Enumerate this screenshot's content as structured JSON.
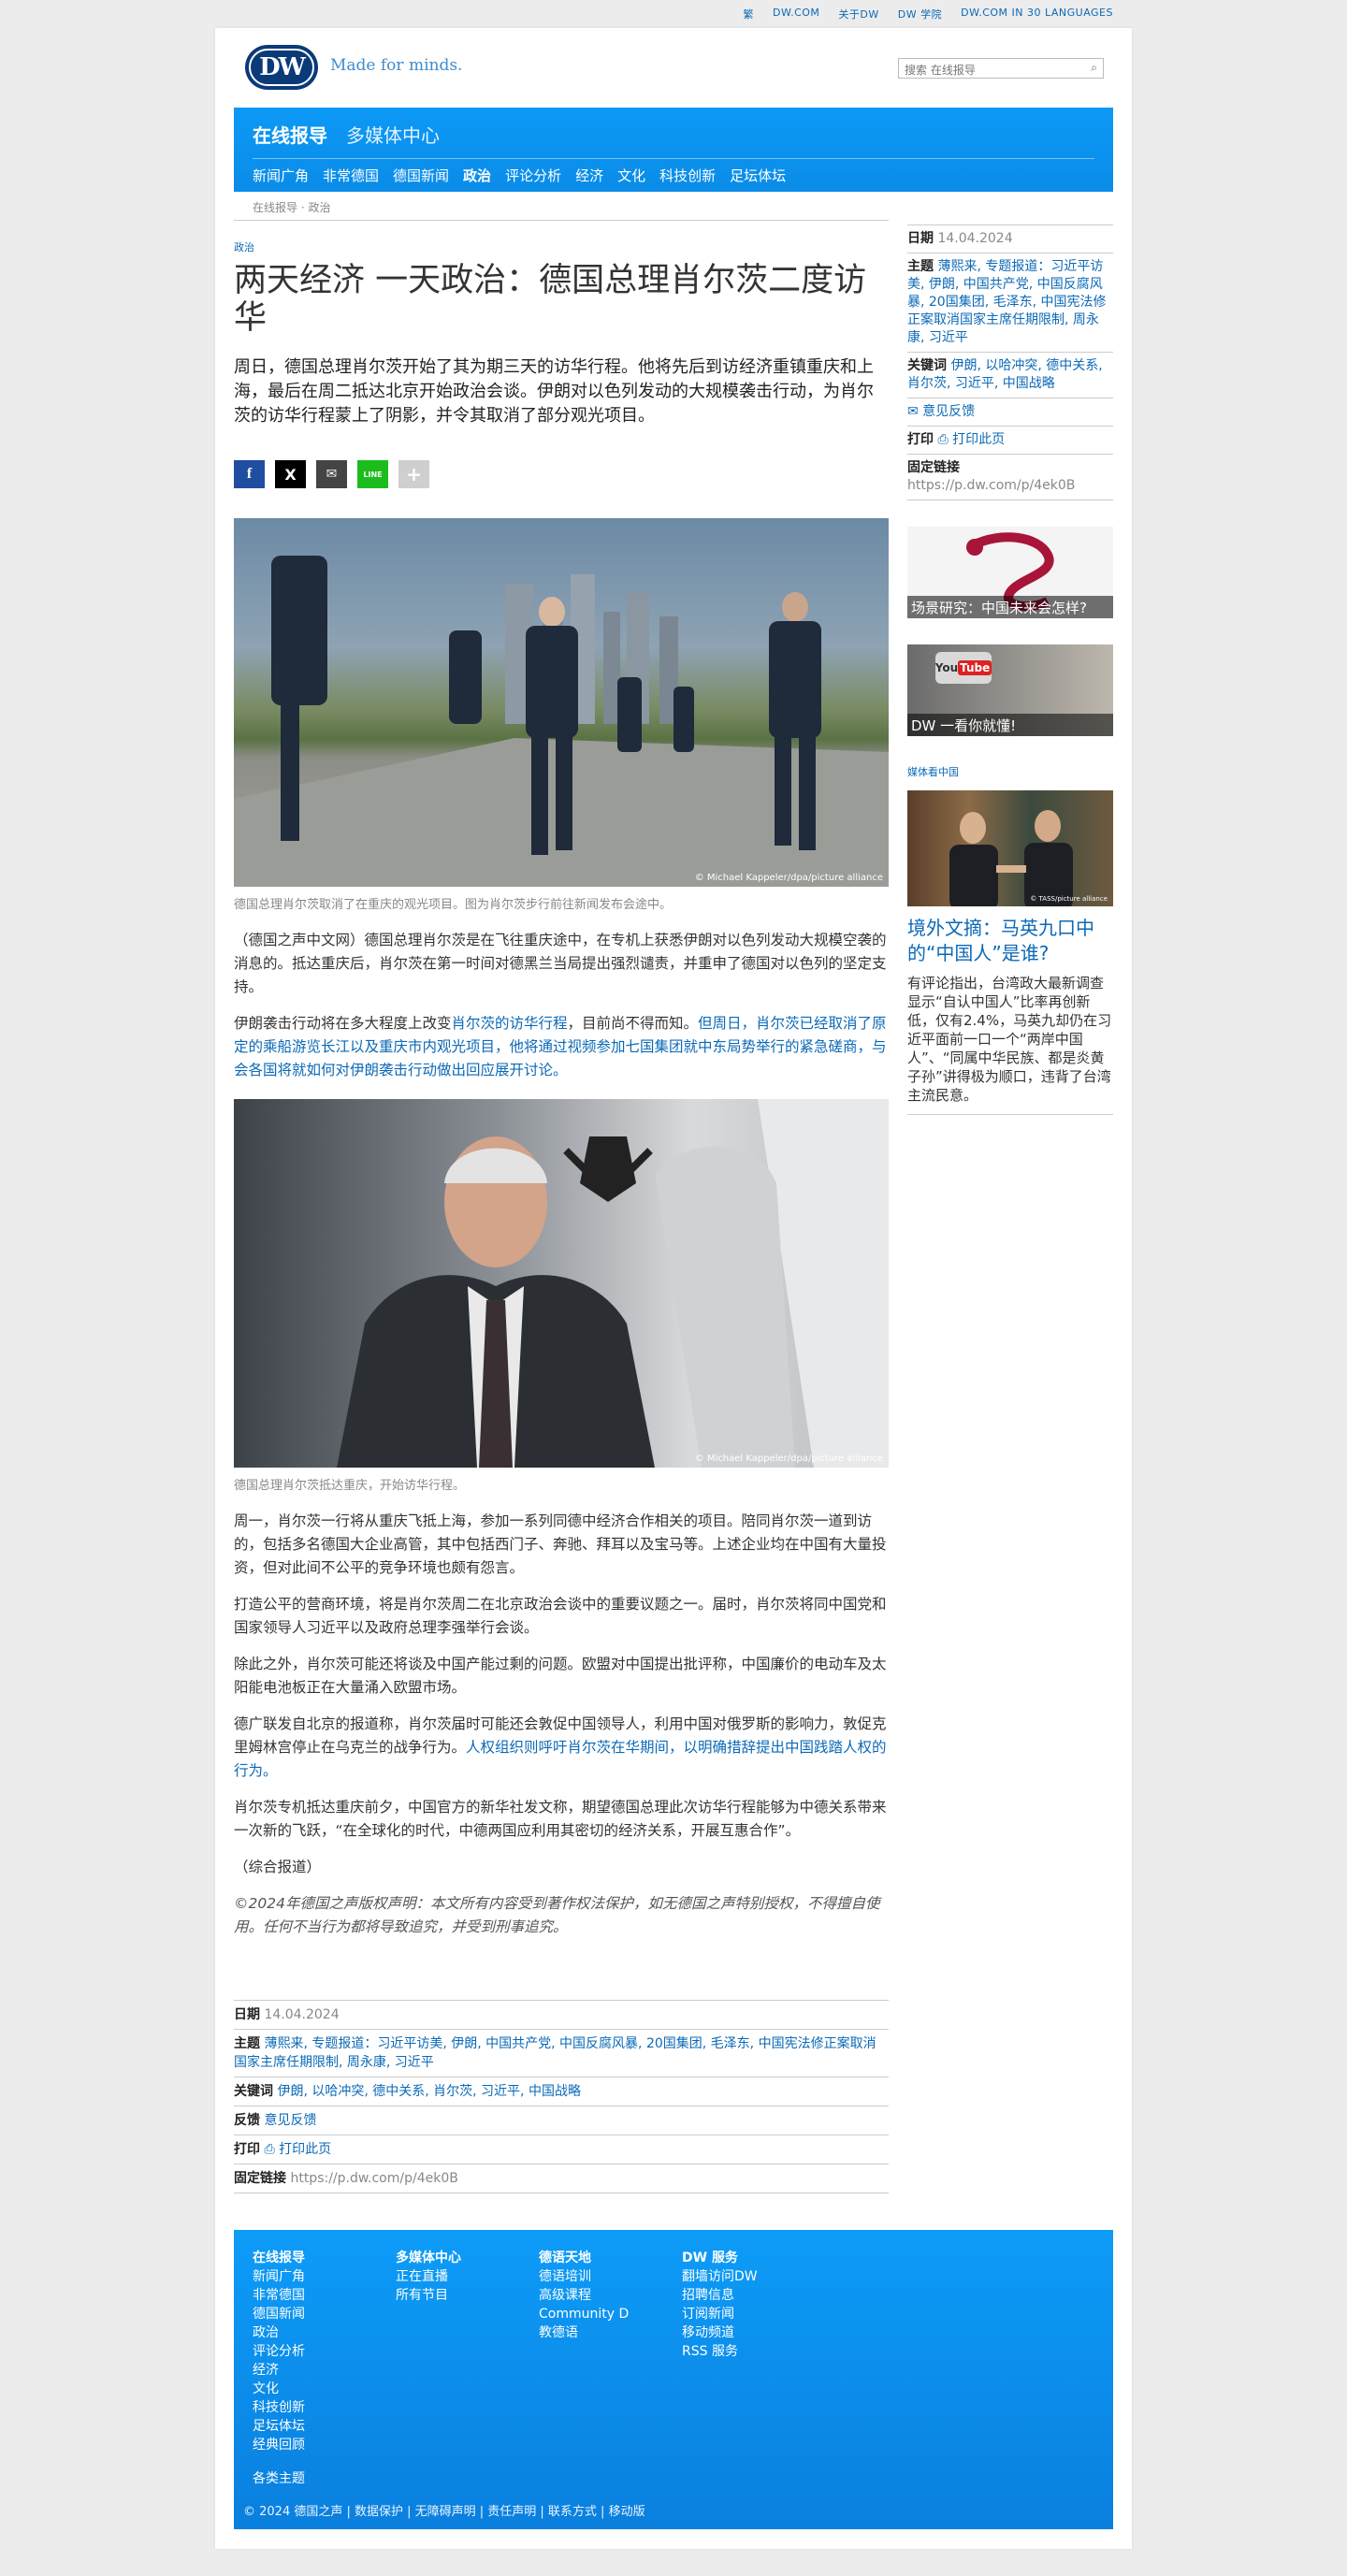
{
  "top_links": [
    "繁",
    "DW.COM",
    "关于DW",
    "DW 学院",
    "DW.COM IN 30 LANGUAGES"
  ],
  "header": {
    "logo_text": "DW",
    "tagline": "Made for minds.",
    "search_placeholder": "搜索 在线报导"
  },
  "nav": {
    "primary": [
      "在线报导",
      "多媒体中心"
    ],
    "secondary": [
      "新闻广角",
      "非常德国",
      "德国新闻",
      "政治",
      "评论分析",
      "经济",
      "文化",
      "科技创新",
      "足坛体坛"
    ],
    "active_secondary": "政治"
  },
  "breadcrumb": "在线报导 · 政治",
  "article": {
    "kicker": "政治",
    "title": "两天经济 一天政治：德国总理肖尔茨二度访华",
    "lead": "周日，德国总理肖尔茨开始了其为期三天的访华行程。他将先后到访经济重镇重庆和上海，最后在周二抵达北京开始政治会谈。伊朗对以色列发动的大规模袭击行动，为肖尔茨的访华行程蒙上了阴影，并令其取消了部分观光项目。",
    "share": [
      "f",
      "X",
      "✉",
      "LINE",
      "+"
    ],
    "image1_credit": "© Michael Kappeler/dpa/picture alliance",
    "image1_caption": "德国总理肖尔茨取消了在重庆的观光项目。图为肖尔茨步行前往新闻发布会途中。",
    "p1": "（德国之声中文网）德国总理肖尔茨是在飞往重庆途中，在专机上获悉伊朗对以色列发动大规模空袭的消息的。抵达重庆后，肖尔茨在第一时间对德黑兰当局提出强烈谴责，并重申了德国对以色列的坚定支持。",
    "p2_a": "伊朗袭击行动将在多大程度上改变",
    "p2_link1": "肖尔茨的访华行程",
    "p2_b": "，目前尚不得而知。",
    "p2_link2": "但周日，肖尔茨已经取消了原定的乘船游览长江以及重庆市内观光项目，他将通过视频参加七国集团就中东局势举行的紧急磋商，与会各国将就如何对伊朗袭击行动做出回应展开讨论。",
    "image2_credit": "© Michael Kappeler/dpa/picture alliance",
    "image2_caption": "德国总理肖尔茨抵达重庆，开始访华行程。",
    "p3": "周一，肖尔茨一行将从重庆飞抵上海，参加一系列同德中经济合作相关的项目。陪同肖尔茨一道到访的，包括多名德国大企业高管，其中包括西门子、奔驰、拜耳以及宝马等。上述企业均在中国有大量投资，但对此间不公平的竞争环境也颇有怨言。",
    "p4": "打造公平的营商环境，将是肖尔茨周二在北京政治会谈中的重要议题之一。届时，肖尔茨将同中国党和国家领导人习近平以及政府总理李强举行会谈。",
    "p5": "除此之外，肖尔茨可能还将谈及中国产能过剩的问题。欧盟对中国提出批评称，中国廉价的电动车及太阳能电池板正在大量涌入欧盟市场。",
    "p6_a": "德广联发自北京的报道称，肖尔茨届时可能还会敦促中国领导人，利用中国对俄罗斯的影响力，敦促克里姆林宫停止在乌克兰的战争行为。",
    "p6_link": "人权组织则呼吁肖尔茨在华期间，以明确措辞提出中国践踏人权的行为。",
    "p7": "肖尔茨专机抵达重庆前夕，中国官方的新华社发文称，期望德国总理此次访华行程能够为中德关系带来一次新的飞跃，“在全球化的时代，中德两国应利用其密切的经济关系，开展互惠合作”。",
    "p8": "（综合报道）",
    "copyright": "©2024年德国之声版权声明：本文所有内容受到著作权法保护，如无德国之声特别授权，不得擅自使用。任何不当行为都将导致追究，并受到刑事追究。"
  },
  "meta": {
    "date_label": "日期",
    "date": "14.04.2024",
    "topics_label": "主题",
    "topics": "薄熙来, 专题报道：习近平访美, 伊朗, 中国共产党, 中国反腐风暴, 20国集团, 毛泽东, 中国宪法修正案取消国家主席任期限制, 周永康, 习近平",
    "keywords_label": "关键词",
    "keywords": "伊朗, 以哈冲突, 德中关系, 肖尔茨, 习近平, 中国战略",
    "feedback_label": "反馈",
    "feedback": "意见反馈",
    "print_label": "打印",
    "print": "打印此页",
    "permalink_label": "固定链接",
    "permalink": "https://p.dw.com/p/4ek0B"
  },
  "sidebar": {
    "feedback": "✉ 意见反馈",
    "teasers": [
      "场景研究：中国未来会怎样?",
      "DW 一看你就懂!"
    ],
    "section": "媒体看中国",
    "feature_title": "境外文摘：马英九口中的“中国人”是谁?",
    "feature_text": "有评论指出，台湾政大最新调查显示“自认中国人”比率再创新低，仅有2.4%，马英九却仍在习近平面前一口一个“两岸中国人”、“同属中华民族、都是炎黄子孙”讲得极为顺口，违背了台湾主流民意。",
    "feature_credit": "© TASS/picture alliance"
  },
  "footer": {
    "cols": [
      {
        "h": "在线报导",
        "items": [
          "新闻广角",
          "非常德国",
          "德国新闻",
          "政治",
          "评论分析",
          "经济",
          "文化",
          "科技创新",
          "足坛体坛",
          "经典回顾"
        ]
      },
      {
        "h": "多媒体中心",
        "items": [
          "正在直播",
          "所有节目"
        ]
      },
      {
        "h": "德语天地",
        "items": [
          "德语培训",
          "高级课程",
          "Community D",
          "教德语"
        ]
      },
      {
        "h": "DW 服务",
        "items": [
          "翻墙访问DW",
          "招聘信息",
          "订阅新闻",
          "移动频道",
          "RSS 服务"
        ]
      }
    ],
    "tags": "各类主题",
    "legal": "© 2024 德国之声 | 数据保护 | 无障碍声明 | 责任声明 | 联系方式 | 移动版"
  }
}
